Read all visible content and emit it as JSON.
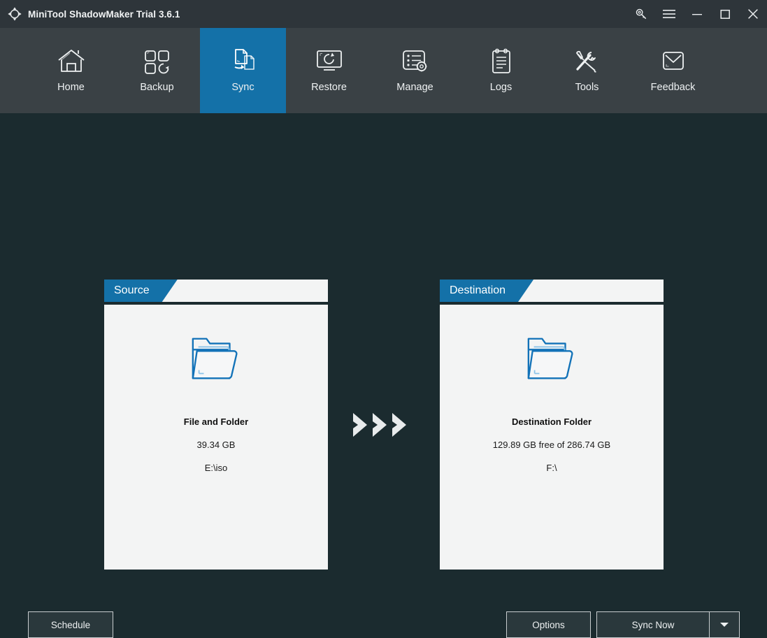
{
  "window": {
    "title": "MiniTool ShadowMaker Trial 3.6.1",
    "logo_icon": "sync-arrows-logo-icon",
    "controls": [
      {
        "name": "key-icon",
        "label": "Register"
      },
      {
        "name": "hamburger-menu-icon",
        "label": "Menu"
      },
      {
        "name": "minimize-icon",
        "label": "Minimize"
      },
      {
        "name": "maximize-icon",
        "label": "Maximize"
      },
      {
        "name": "close-icon",
        "label": "Close"
      }
    ]
  },
  "nav": {
    "active": "Sync",
    "items": [
      {
        "label": "Home",
        "icon": "home-icon"
      },
      {
        "label": "Backup",
        "icon": "backup-squares-icon"
      },
      {
        "label": "Sync",
        "icon": "sync-documents-icon"
      },
      {
        "label": "Restore",
        "icon": "restore-monitor-icon"
      },
      {
        "label": "Manage",
        "icon": "manage-list-gear-icon"
      },
      {
        "label": "Logs",
        "icon": "logs-clipboard-icon"
      },
      {
        "label": "Tools",
        "icon": "tools-wrench-screwdriver-icon"
      },
      {
        "label": "Feedback",
        "icon": "feedback-envelope-icon"
      }
    ]
  },
  "main": {
    "source": {
      "tab_label": "Source",
      "icon": "open-folder-icon",
      "title": "File and Folder",
      "size": "39.34 GB",
      "path": "E:\\iso"
    },
    "destination": {
      "tab_label": "Destination",
      "icon": "open-folder-icon",
      "title": "Destination Folder",
      "size": "129.89 GB free of 286.74 GB",
      "path": "F:\\"
    },
    "arrows_icon": "triple-chevron-right-icon"
  },
  "footer": {
    "schedule_label": "Schedule",
    "options_label": "Options",
    "sync_now_label": "Sync Now",
    "sync_now_dropdown_icon": "chevron-down-icon"
  },
  "colors": {
    "accent_blue": "#1471a8",
    "titlebar_bg": "#2e353a",
    "navbar_bg": "#3a4145",
    "content_bg": "#1b2b2f",
    "panel_bg": "#f3f4f4",
    "folder_outline": "#1272b8"
  }
}
